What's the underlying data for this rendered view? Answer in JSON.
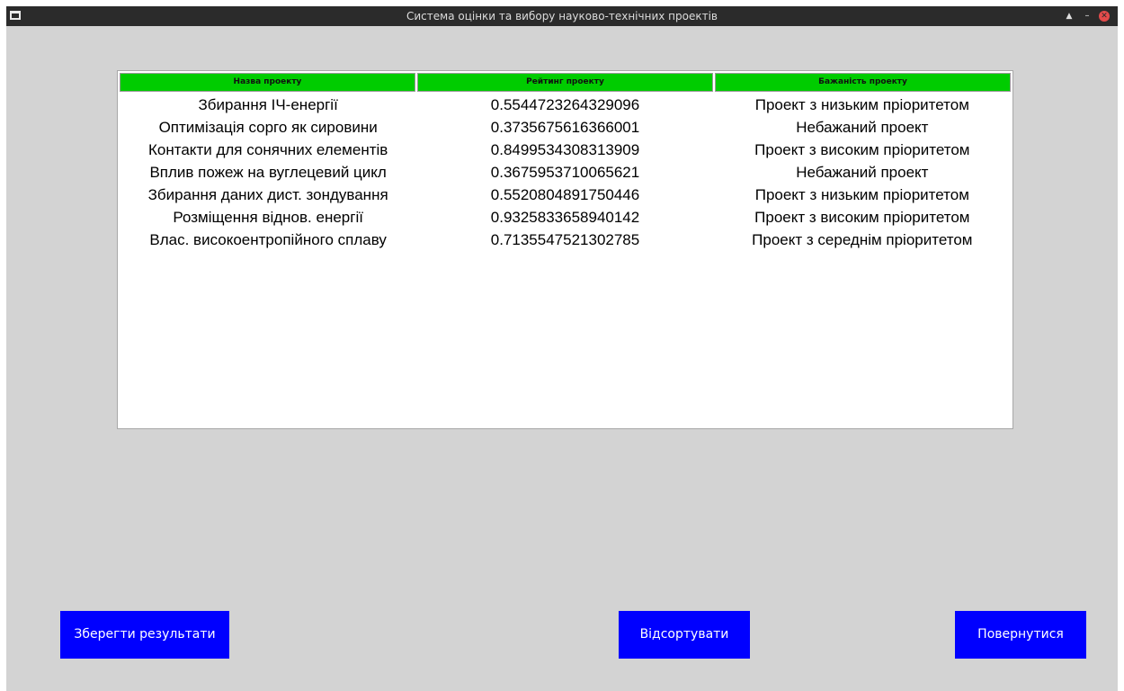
{
  "window": {
    "title": "Система оцінки та вибору науково-технічних проектів",
    "controls": {
      "shade_glyph": "▲",
      "minimize_glyph": "–",
      "close_glyph": "✕"
    }
  },
  "table": {
    "headers": [
      "Назва проекту",
      "Рейтинг проекту",
      "Бажаність проекту"
    ],
    "header_color": "#00cc00",
    "rows": [
      [
        "Збирання ІЧ-енергії",
        "0.5544723264329096",
        "Проект з низьким пріоритетом"
      ],
      [
        "Оптимізація сорго як сировини",
        "0.3735675616366001",
        "Небажаний проект"
      ],
      [
        "Контакти для сонячних елементів",
        "0.8499534308313909",
        "Проект з високим пріоритетом"
      ],
      [
        "Вплив пожеж на вуглецевий цикл",
        "0.3675953710065621",
        "Небажаний проект"
      ],
      [
        "Збирання даних дист. зондування",
        "0.5520804891750446",
        "Проект з низьким пріоритетом"
      ],
      [
        "Розміщення віднов. енергії",
        "0.9325833658940142",
        "Проект з високим пріоритетом"
      ],
      [
        "Влас. високоентропійного сплаву",
        "0.7135547521302785",
        "Проект з середнім пріоритетом"
      ]
    ]
  },
  "buttons": {
    "save_label": "Зберегти результати",
    "sort_label": "Відсортувати",
    "back_label": "Повернутися",
    "color": "#0000ff"
  }
}
